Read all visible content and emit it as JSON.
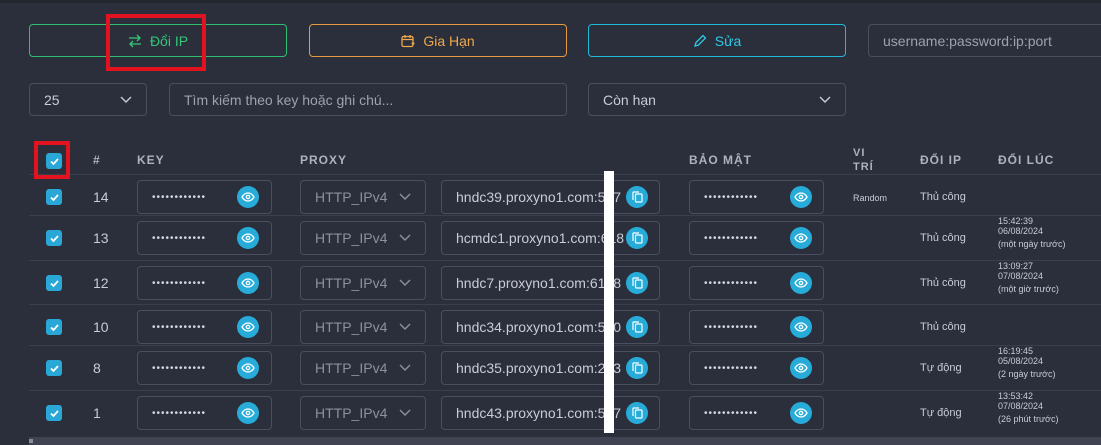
{
  "toolbar": {
    "change_ip_label": "Đổi IP",
    "extend_label": "Gia Hạn",
    "edit_label": "Sửa",
    "credentials_placeholder": "username:password:ip:port",
    "colors": {
      "change_ip": "#34c777",
      "extend": "#f0a84b",
      "edit": "#2ccbe6"
    }
  },
  "filters": {
    "per_page": "25",
    "search_placeholder": "Tìm kiếm theo key hoặc ghi chú...",
    "status": "Còn hạn"
  },
  "table": {
    "headers": {
      "index": "#",
      "key": "KEY",
      "proxy": "PROXY",
      "security": "BẢO MẬT",
      "location_line1": "VI",
      "location_line2": "TRÍ",
      "change_ip": "ĐỔI IP",
      "changed_at": "ĐỔI LÚC"
    },
    "select_all_checked": true,
    "rows": [
      {
        "num": "14",
        "key": "••••••••••••",
        "protocol": "HTTP_IPv4",
        "host": "hndc39.proxyno1.com:577",
        "password": "••••••••••••",
        "location": "Random",
        "change_mode": "Thủ công",
        "changed_time": "",
        "changed_date": "",
        "changed_relative": ""
      },
      {
        "num": "13",
        "key": "••••••••••••",
        "protocol": "HTTP_IPv4",
        "host": "hcmdc1.proxyno1.com:618",
        "password": "••••••••••••",
        "location": "",
        "change_mode": "Thủ công",
        "changed_time": "15:42:39",
        "changed_date": "06/08/2024",
        "changed_relative": "(một ngày trước)"
      },
      {
        "num": "12",
        "key": "••••••••••••",
        "protocol": "HTTP_IPv4",
        "host": "hndc7.proxyno1.com:6188",
        "password": "••••••••••••",
        "location": "",
        "change_mode": "Thủ công",
        "changed_time": "13:09:27",
        "changed_date": "07/08/2024",
        "changed_relative": "(một giờ trước)"
      },
      {
        "num": "10",
        "key": "••••••••••••",
        "protocol": "HTTP_IPv4",
        "host": "hndc34.proxyno1.com:500",
        "password": "••••••••••••",
        "location": "",
        "change_mode": "Thủ công",
        "changed_time": "",
        "changed_date": "",
        "changed_relative": ""
      },
      {
        "num": "8",
        "key": "••••••••••••",
        "protocol": "HTTP_IPv4",
        "host": "hndc35.proxyno1.com:233",
        "password": "••••••••••••",
        "location": "",
        "change_mode": "Tự động",
        "changed_time": "16:19:45",
        "changed_date": "05/08/2024",
        "changed_relative": "(2 ngày trước)"
      },
      {
        "num": "1",
        "key": "••••••••••••",
        "protocol": "HTTP_IPv4",
        "host": "hndc43.proxyno1.com:577",
        "password": "••••••••••••",
        "location": "",
        "change_mode": "Tự động",
        "changed_time": "13:53:42",
        "changed_date": "07/08/2024",
        "changed_relative": "(26 phút trước)"
      }
    ]
  }
}
